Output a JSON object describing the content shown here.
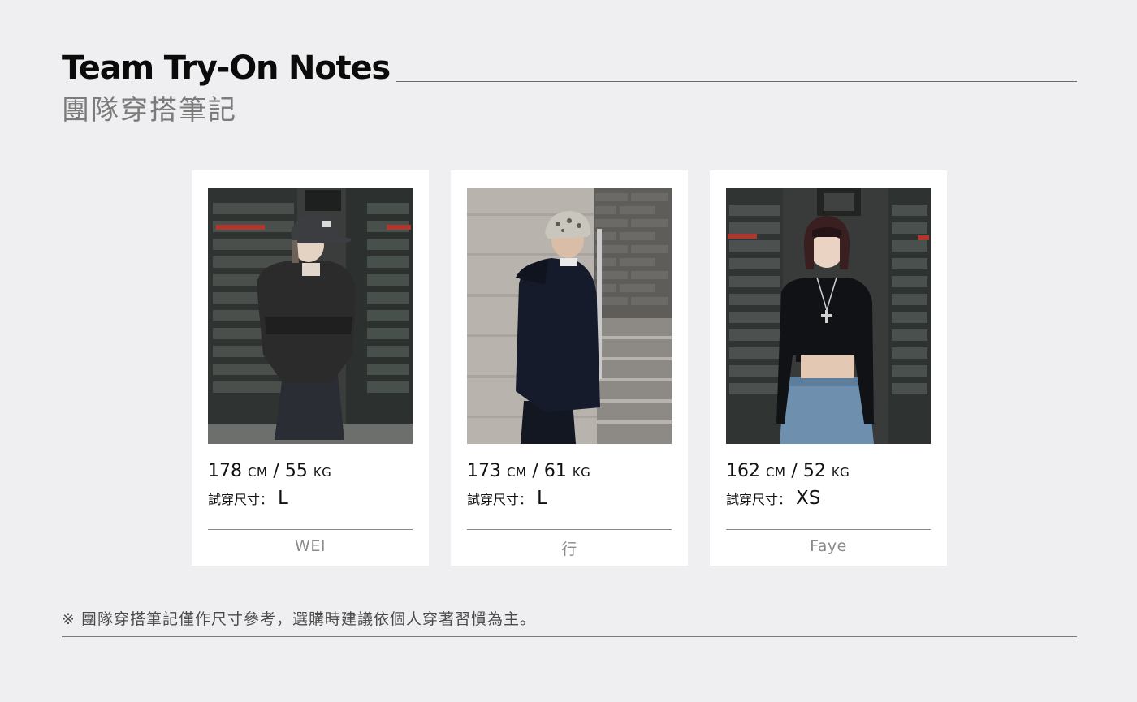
{
  "header": {
    "title": "Team Try-On Notes",
    "subtitle": "團隊穿搭筆記"
  },
  "size_label": "試穿尺寸：",
  "cards": [
    {
      "height": "178",
      "height_unit": "CM",
      "separator": "/",
      "weight": "55",
      "weight_unit": "KG",
      "size": "L",
      "name": "WEI"
    },
    {
      "height": "173",
      "height_unit": "CM",
      "separator": "/",
      "weight": "61",
      "weight_unit": "KG",
      "size": "L",
      "name": "行"
    },
    {
      "height": "162",
      "height_unit": "CM",
      "separator": "/",
      "weight": "52",
      "weight_unit": "KG",
      "size": "XS",
      "name": "Faye"
    }
  ],
  "footnote": "※ 團隊穿搭筆記僅作尺寸參考，選購時建議依個人穿著習慣為主。",
  "colors": {
    "background": "#efeff1",
    "card": "#ffffff",
    "title": "#0b0b0b",
    "subtitle": "#7b7b7b",
    "muted": "#8a8a8a"
  }
}
